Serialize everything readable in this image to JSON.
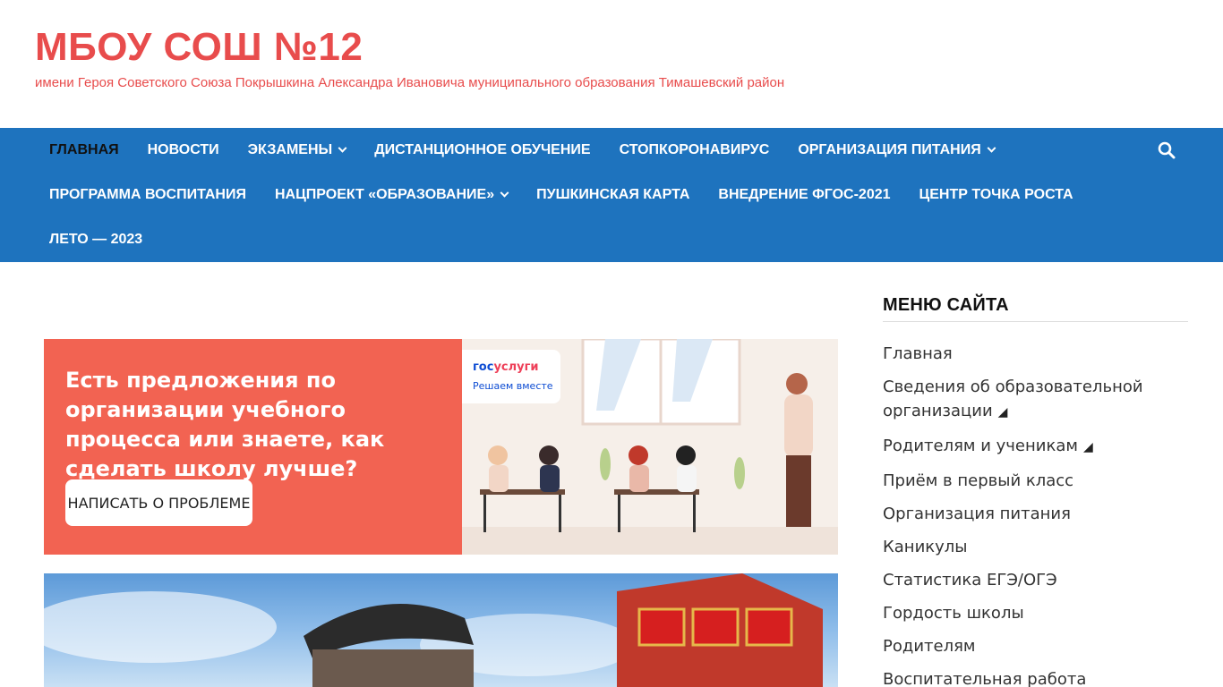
{
  "header": {
    "title": "МБОУ СОШ №12",
    "description": "имени Героя Советского Союза Покрышкина Александра Ивановича муниципального образования Тимашевский район",
    "title_color": "#e84c4c"
  },
  "nav": {
    "background": "#1e73be",
    "rows": [
      [
        {
          "label": "Главная",
          "active": true,
          "caret": false
        },
        {
          "label": "Новости",
          "caret": false
        },
        {
          "label": "Экзамены",
          "caret": true
        },
        {
          "label": "Дистанционное обучение",
          "caret": false
        },
        {
          "label": "СТОПКОРОНАВИРУС",
          "caret": false
        },
        {
          "label": "Организация питания",
          "caret": true
        }
      ],
      [
        {
          "label": "Программа воспитания",
          "caret": false
        },
        {
          "label": "Нацпроект «Образование»",
          "caret": true
        },
        {
          "label": "Пушкинская карта",
          "caret": false
        },
        {
          "label": "Внедрение ФГОС-2021",
          "caret": false
        },
        {
          "label": "Центр Точка роста",
          "caret": false
        }
      ],
      [
        {
          "label": "ЛЕТО — 2023",
          "caret": false
        }
      ]
    ],
    "search_icon": "search-icon"
  },
  "banner": {
    "text": "Есть предложения по организации учебного процесса или знаете, как сделать школу лучше?",
    "button_label": "НАПИСАТЬ О ПРОБЛЕМЕ",
    "brand_part1": "гос",
    "brand_part2": "услуги",
    "brand_sub": "Решаем вместе",
    "background": "#f26352"
  },
  "sidebar": {
    "title": "МЕНЮ САЙТА",
    "items": [
      {
        "label": "Главная",
        "submenu": false
      },
      {
        "label": "Сведения об образовательной организации",
        "submenu": true
      },
      {
        "label": "Родителям и ученикам",
        "submenu": true
      },
      {
        "label": "Приём в первый класс",
        "submenu": false
      },
      {
        "label": "Организация питания",
        "submenu": false
      },
      {
        "label": "Каникулы",
        "submenu": false
      },
      {
        "label": "Статистика ЕГЭ/ОГЭ",
        "submenu": false
      },
      {
        "label": "Гордость школы",
        "submenu": false
      },
      {
        "label": "Родителям",
        "submenu": false
      },
      {
        "label": "Воспитательная работа",
        "submenu": false
      }
    ],
    "submenu_glyph": "◢"
  }
}
